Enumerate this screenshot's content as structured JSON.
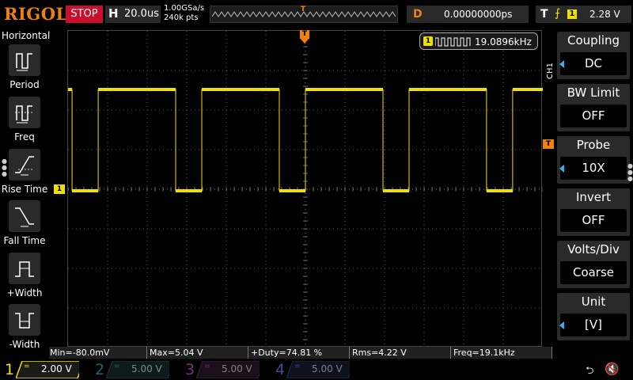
{
  "topbar": {
    "brand": "RIGOL",
    "run_state": "STOP",
    "horizontal_key": "H",
    "timebase": "20.0us",
    "sample_rate": "1.00GSa/s",
    "memory_depth": "240k pts",
    "trigger_pos_label": "T",
    "delay_key": "D",
    "delay_value": "0.00000000ps",
    "trigger_key": "T",
    "trigger_source": "1",
    "trigger_level": "2.28 V"
  },
  "left_menu": {
    "title": "Horizontal",
    "items": [
      {
        "label": "Period",
        "icon": "period-icon"
      },
      {
        "label": "Freq",
        "icon": "freq-icon"
      },
      {
        "label": "Rise Time",
        "icon": "rise-time-icon"
      },
      {
        "label": "Fall Time",
        "icon": "fall-time-icon"
      },
      {
        "label": "+Width",
        "icon": "positive-width-icon"
      },
      {
        "label": "-Width",
        "icon": "negative-width-icon"
      }
    ]
  },
  "screen": {
    "trigger_marker_label": "T",
    "ch1_marker_label": "1",
    "trigger_level_marker": "T",
    "freq_counter": {
      "channel": "1",
      "value": "19.0896kHz"
    }
  },
  "right_menu": {
    "channel_tab": "CH1",
    "items": [
      {
        "title": "Coupling",
        "value": "DC",
        "has_arrow": true
      },
      {
        "title": "BW Limit",
        "value": "OFF",
        "has_arrow": false
      },
      {
        "title": "Probe",
        "value": "10X",
        "has_arrow": true
      },
      {
        "title": "Invert",
        "value": "OFF",
        "has_arrow": false
      },
      {
        "title": "Volts/Div",
        "value": "Coarse",
        "has_arrow": false
      },
      {
        "title": "Unit",
        "value": "[V]",
        "has_arrow": true
      }
    ]
  },
  "measurements": [
    "Min=-80.0mV",
    "Max=5.04 V",
    "+Duty=74.81 %",
    "Rms=4.22 V",
    "Freq=19.1kHz"
  ],
  "channels": [
    {
      "number": "1",
      "coupling": "=",
      "scale": "2.00 V",
      "color": "#f0e000",
      "active": true
    },
    {
      "number": "2",
      "coupling": "=",
      "scale": "5.00 V",
      "color": "#20b0c0",
      "active": false
    },
    {
      "number": "3",
      "coupling": "=",
      "scale": "5.00 V",
      "color": "#d040d0",
      "active": false
    },
    {
      "number": "4",
      "coupling": "=",
      "scale": "5.00 V",
      "color": "#3070e0",
      "active": false
    }
  ],
  "status_icons": [
    "usb-icon",
    "speaker-muted-icon"
  ],
  "waveform": {
    "channel": "1",
    "color": "#f0e000",
    "high_v": 5.04,
    "low_v": -0.08,
    "volts_per_div": 2.0,
    "time_per_div_us": 20.0,
    "frequency_khz": 19.0896,
    "duty_percent": 74.81
  }
}
